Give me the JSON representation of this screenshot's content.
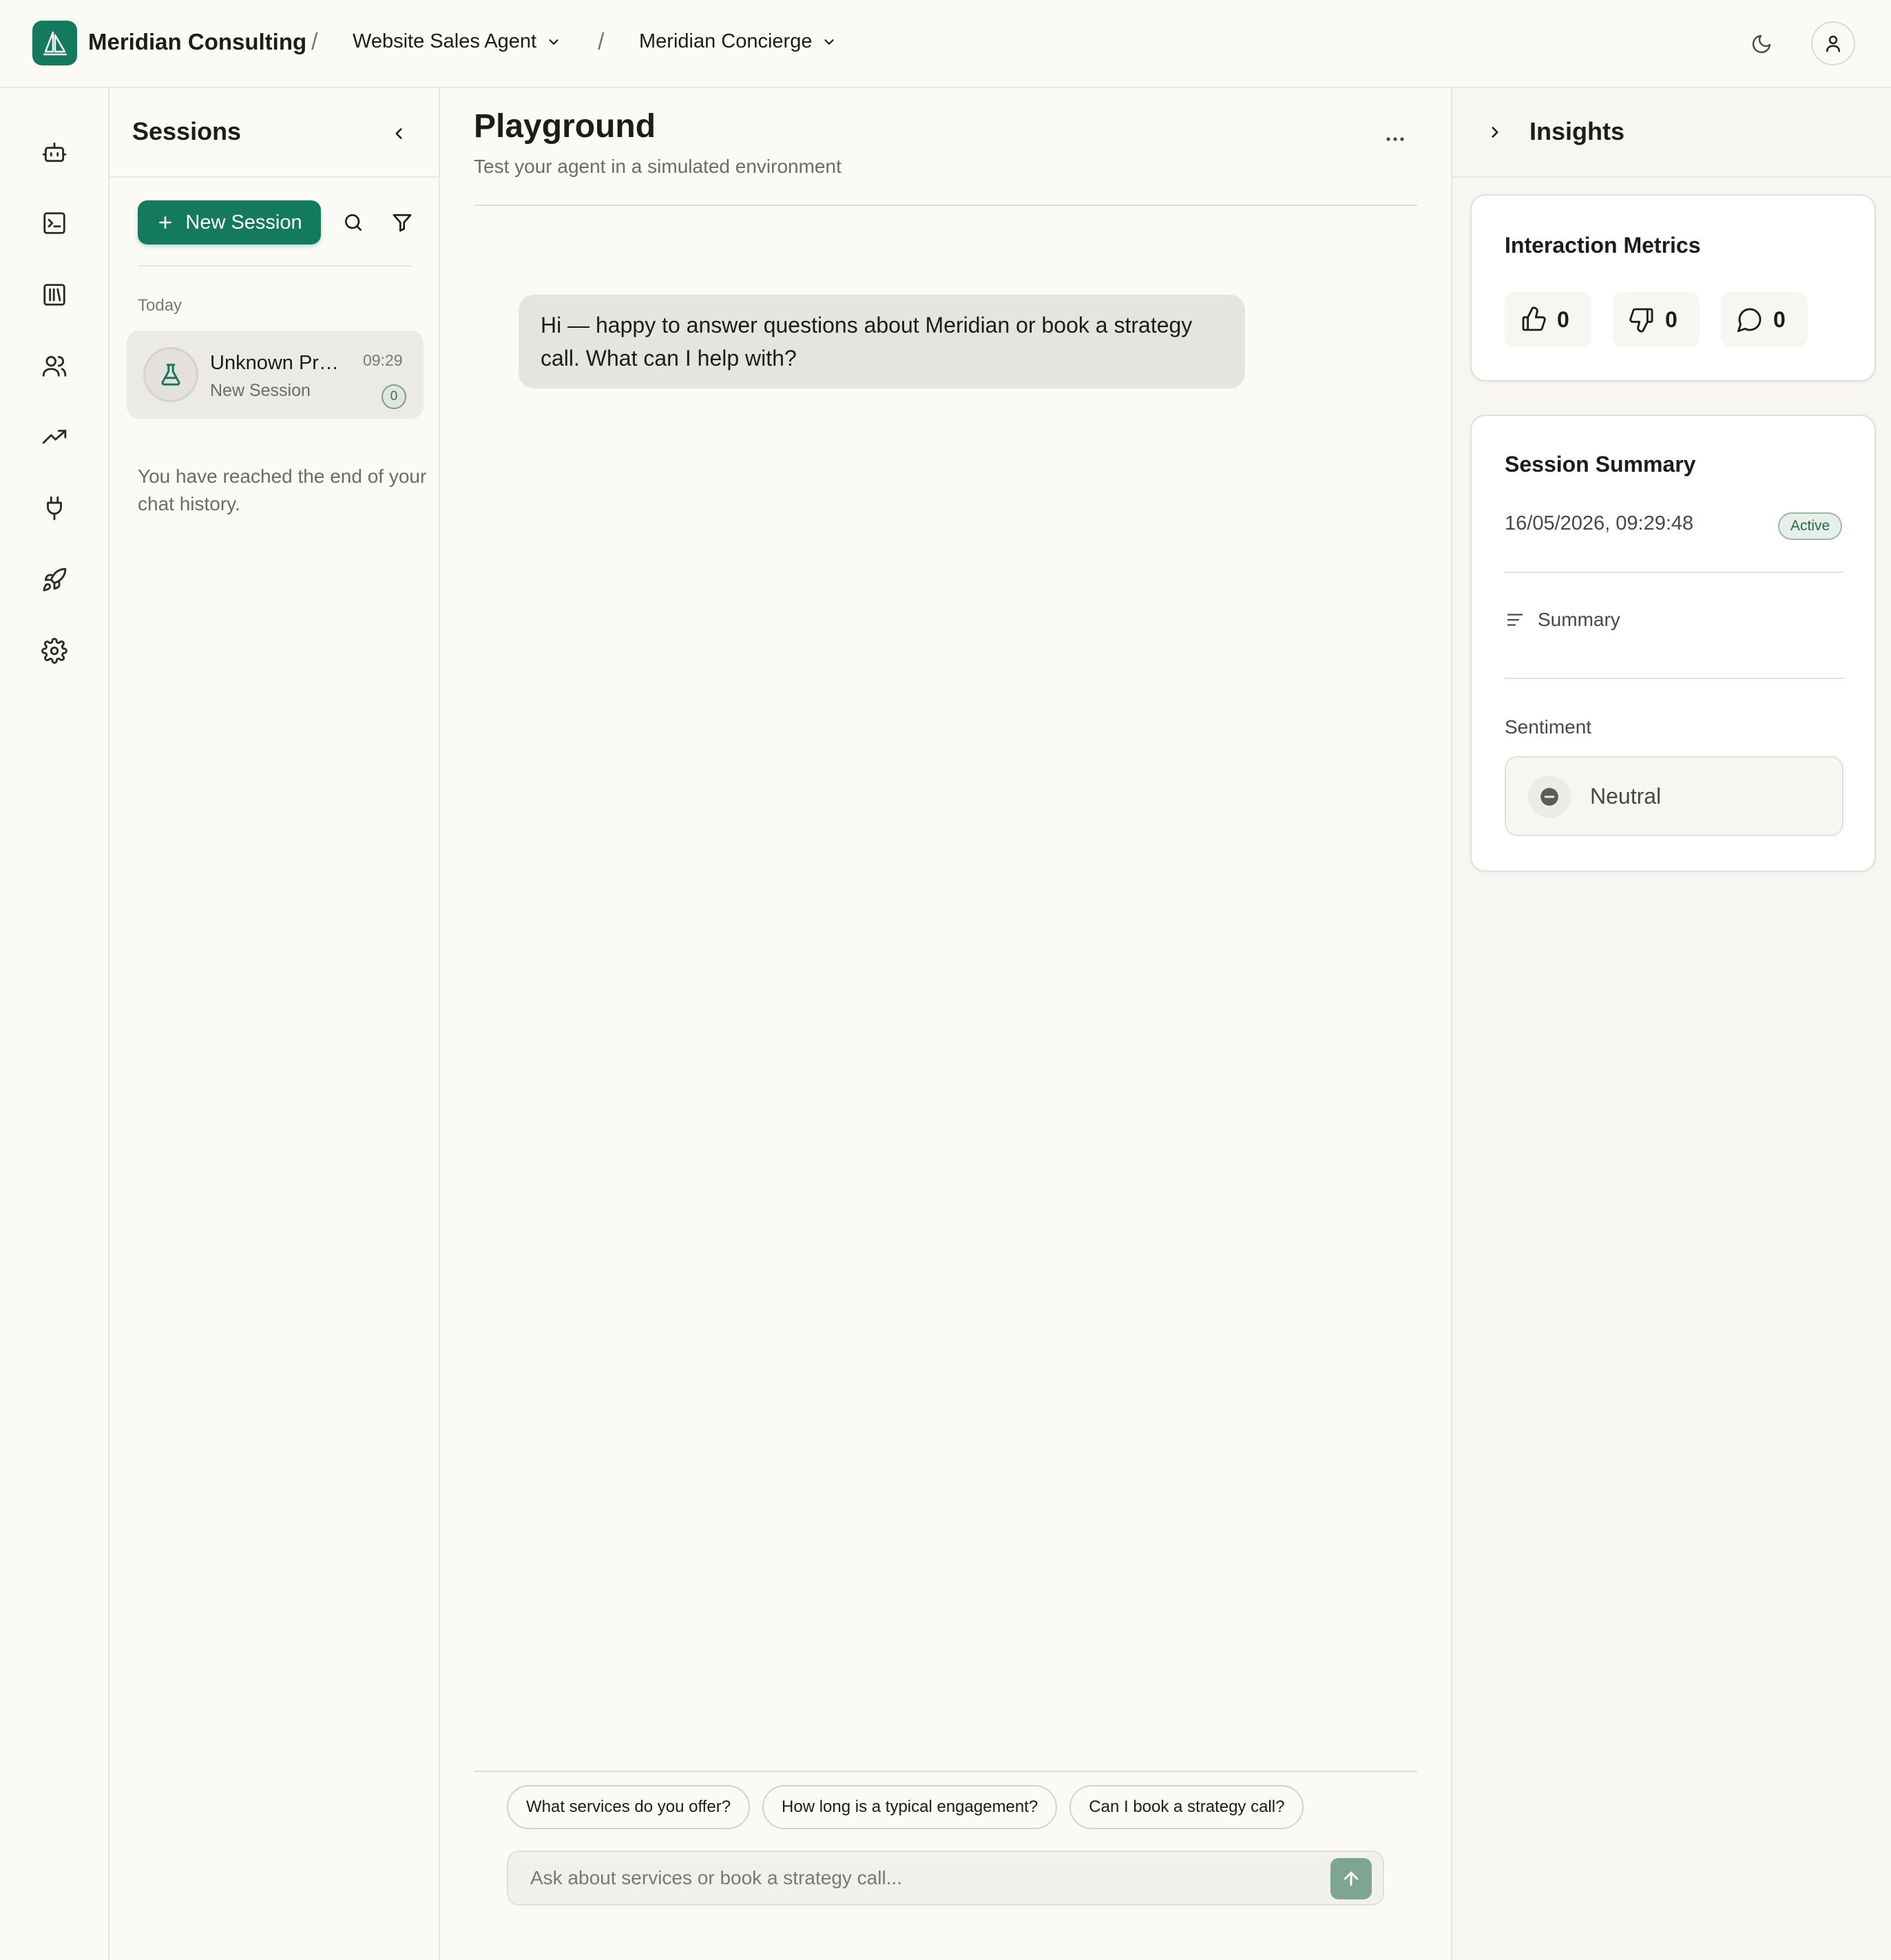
{
  "topbar": {
    "org_name": "Meridian Consulting",
    "separator": "/",
    "agent_label": "Website Sales Agent",
    "persona_label": "Meridian Concierge",
    "icons": [
      "logo-sail-icon",
      "chevron-down-icon",
      "moon-icon",
      "user-icon"
    ]
  },
  "rail": {
    "items": [
      "bot-icon",
      "terminal-icon",
      "library-icon",
      "users-icon",
      "trending-up-icon",
      "plug-icon",
      "rocket-icon",
      "settings-icon"
    ]
  },
  "sessions": {
    "title": "Sessions",
    "new_session_label": "New Session",
    "group_label": "Today",
    "items": [
      {
        "name": "Unknown Profile",
        "time": "09:29",
        "subtitle": "New Session",
        "count": "0"
      }
    ],
    "end_note": "You have reached the end of your chat history."
  },
  "playground": {
    "title": "Playground",
    "subtitle": "Test your agent in a simulated environment",
    "messages": [
      {
        "role": "agent",
        "text": "Hi — happy to answer questions about Meridian or book a strategy call. What can I help with?"
      }
    ],
    "suggestions": [
      "What services do you offer?",
      "How long is a typical engagement?",
      "Can I book a strategy call?"
    ],
    "input_placeholder": "Ask about services or book a strategy call..."
  },
  "insights": {
    "title": "Insights",
    "metrics": {
      "title": "Interaction Metrics",
      "thumbs_up": "0",
      "thumbs_down": "0",
      "comments": "0"
    },
    "summary": {
      "title": "Session Summary",
      "datetime": "16/05/2026, 09:29:48",
      "status": "Active",
      "summary_label": "Summary",
      "sentiment_label": "Sentiment",
      "sentiment_value": "Neutral"
    }
  },
  "colors": {
    "brand": "#147a5e",
    "background": "#fcfaf7",
    "bubble": "#e6e4e0",
    "send_button": "#7ea493"
  }
}
